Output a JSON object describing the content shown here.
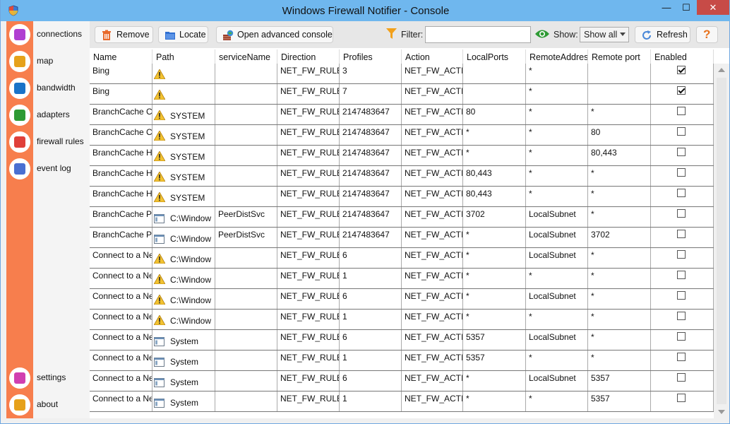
{
  "window": {
    "title": "Windows Firewall Notifier - Console",
    "min": "—",
    "max": "☐",
    "close": "✕"
  },
  "nav": [
    {
      "label": "connections",
      "icon": "connections-icon",
      "color": "#b03fd1"
    },
    {
      "label": "map",
      "icon": "map-icon",
      "color": "#e6a11a"
    },
    {
      "label": "bandwidth",
      "icon": "bandwidth-icon",
      "color": "#1a73c8"
    },
    {
      "label": "adapters",
      "icon": "adapters-icon",
      "color": "#2e9a34"
    },
    {
      "label": "firewall rules",
      "icon": "filter-icon",
      "color": "#e0403a"
    },
    {
      "label": "event log",
      "icon": "event-log-icon",
      "color": "#4a6fd1"
    },
    {
      "label": "settings",
      "icon": "gear-icon",
      "color": "#d13fb0"
    },
    {
      "label": "about",
      "icon": "info-icon",
      "color": "#e6a11a"
    }
  ],
  "toolbar": {
    "remove": "Remove",
    "locate": "Locate",
    "advanced": "Open advanced console",
    "filter_label": "Filter:",
    "filter_value": "",
    "show_label": "Show:",
    "show_value": "Show all",
    "refresh": "Refresh",
    "help": "?"
  },
  "table": {
    "columns": [
      "Name",
      "Path",
      "serviceName",
      "Direction",
      "Profiles",
      "Action",
      "LocalPorts",
      "RemoteAddres",
      "Remote port",
      "Enabled"
    ],
    "rows": [
      {
        "name": "Bing",
        "icon": "warn",
        "path": "",
        "service": "",
        "direction": "NET_FW_RULE_",
        "profiles": "3",
        "action": "NET_FW_ACTIO",
        "local": "",
        "raddr": "*",
        "rport": "",
        "enabled": true
      },
      {
        "name": "Bing",
        "icon": "warn",
        "path": "",
        "service": "",
        "direction": "NET_FW_RULE_",
        "profiles": "7",
        "action": "NET_FW_ACTIO",
        "local": "",
        "raddr": "*",
        "rport": "",
        "enabled": true
      },
      {
        "name": "BranchCache Co",
        "icon": "warn",
        "path": "SYSTEM",
        "service": "",
        "direction": "NET_FW_RULE_",
        "profiles": "2147483647",
        "action": "NET_FW_ACTIO",
        "local": "80",
        "raddr": "*",
        "rport": "*",
        "enabled": false
      },
      {
        "name": "BranchCache Co",
        "icon": "warn",
        "path": "SYSTEM",
        "service": "",
        "direction": "NET_FW_RULE_",
        "profiles": "2147483647",
        "action": "NET_FW_ACTIO",
        "local": "*",
        "raddr": "*",
        "rport": "80",
        "enabled": false
      },
      {
        "name": "BranchCache Ho",
        "icon": "warn",
        "path": "SYSTEM",
        "service": "",
        "direction": "NET_FW_RULE_",
        "profiles": "2147483647",
        "action": "NET_FW_ACTIO",
        "local": "*",
        "raddr": "*",
        "rport": "80,443",
        "enabled": false
      },
      {
        "name": "BranchCache Ho",
        "icon": "warn",
        "path": "SYSTEM",
        "service": "",
        "direction": "NET_FW_RULE_",
        "profiles": "2147483647",
        "action": "NET_FW_ACTIO",
        "local": "80,443",
        "raddr": "*",
        "rport": "*",
        "enabled": false
      },
      {
        "name": "BranchCache Ho",
        "icon": "warn",
        "path": "SYSTEM",
        "service": "",
        "direction": "NET_FW_RULE_",
        "profiles": "2147483647",
        "action": "NET_FW_ACTIO",
        "local": "80,443",
        "raddr": "*",
        "rport": "*",
        "enabled": false
      },
      {
        "name": "BranchCache Pe",
        "icon": "exe",
        "path": "C:\\Window",
        "service": "PeerDistSvc",
        "direction": "NET_FW_RULE_",
        "profiles": "2147483647",
        "action": "NET_FW_ACTIO",
        "local": "3702",
        "raddr": "LocalSubnet",
        "rport": "*",
        "enabled": false
      },
      {
        "name": "BranchCache Pe",
        "icon": "exe",
        "path": "C:\\Window",
        "service": "PeerDistSvc",
        "direction": "NET_FW_RULE_",
        "profiles": "2147483647",
        "action": "NET_FW_ACTIO",
        "local": "*",
        "raddr": "LocalSubnet",
        "rport": "3702",
        "enabled": false
      },
      {
        "name": "Connect to a Ne",
        "icon": "warn",
        "path": "C:\\Window",
        "service": "",
        "direction": "NET_FW_RULE_",
        "profiles": "6",
        "action": "NET_FW_ACTIO",
        "local": "*",
        "raddr": "LocalSubnet",
        "rport": "*",
        "enabled": false
      },
      {
        "name": "Connect to a Ne",
        "icon": "warn",
        "path": "C:\\Window",
        "service": "",
        "direction": "NET_FW_RULE_",
        "profiles": "1",
        "action": "NET_FW_ACTIO",
        "local": "*",
        "raddr": "*",
        "rport": "*",
        "enabled": false
      },
      {
        "name": "Connect to a Ne",
        "icon": "warn",
        "path": "C:\\Window",
        "service": "",
        "direction": "NET_FW_RULE_",
        "profiles": "6",
        "action": "NET_FW_ACTIO",
        "local": "*",
        "raddr": "LocalSubnet",
        "rport": "*",
        "enabled": false
      },
      {
        "name": "Connect to a Ne",
        "icon": "warn",
        "path": "C:\\Window",
        "service": "",
        "direction": "NET_FW_RULE_",
        "profiles": "1",
        "action": "NET_FW_ACTIO",
        "local": "*",
        "raddr": "*",
        "rport": "*",
        "enabled": false
      },
      {
        "name": "Connect to a Ne",
        "icon": "exe",
        "path": "System",
        "service": "",
        "direction": "NET_FW_RULE_",
        "profiles": "6",
        "action": "NET_FW_ACTIO",
        "local": "5357",
        "raddr": "LocalSubnet",
        "rport": "*",
        "enabled": false
      },
      {
        "name": "Connect to a Ne",
        "icon": "exe",
        "path": "System",
        "service": "",
        "direction": "NET_FW_RULE_",
        "profiles": "1",
        "action": "NET_FW_ACTIO",
        "local": "5357",
        "raddr": "*",
        "rport": "*",
        "enabled": false
      },
      {
        "name": "Connect to a Ne",
        "icon": "exe",
        "path": "System",
        "service": "",
        "direction": "NET_FW_RULE_",
        "profiles": "6",
        "action": "NET_FW_ACTIO",
        "local": "*",
        "raddr": "LocalSubnet",
        "rport": "5357",
        "enabled": false
      },
      {
        "name": "Connect to a Ne",
        "icon": "exe",
        "path": "System",
        "service": "",
        "direction": "NET_FW_RULE_",
        "profiles": "1",
        "action": "NET_FW_ACTIO",
        "local": "*",
        "raddr": "*",
        "rport": "5357",
        "enabled": false
      }
    ]
  }
}
